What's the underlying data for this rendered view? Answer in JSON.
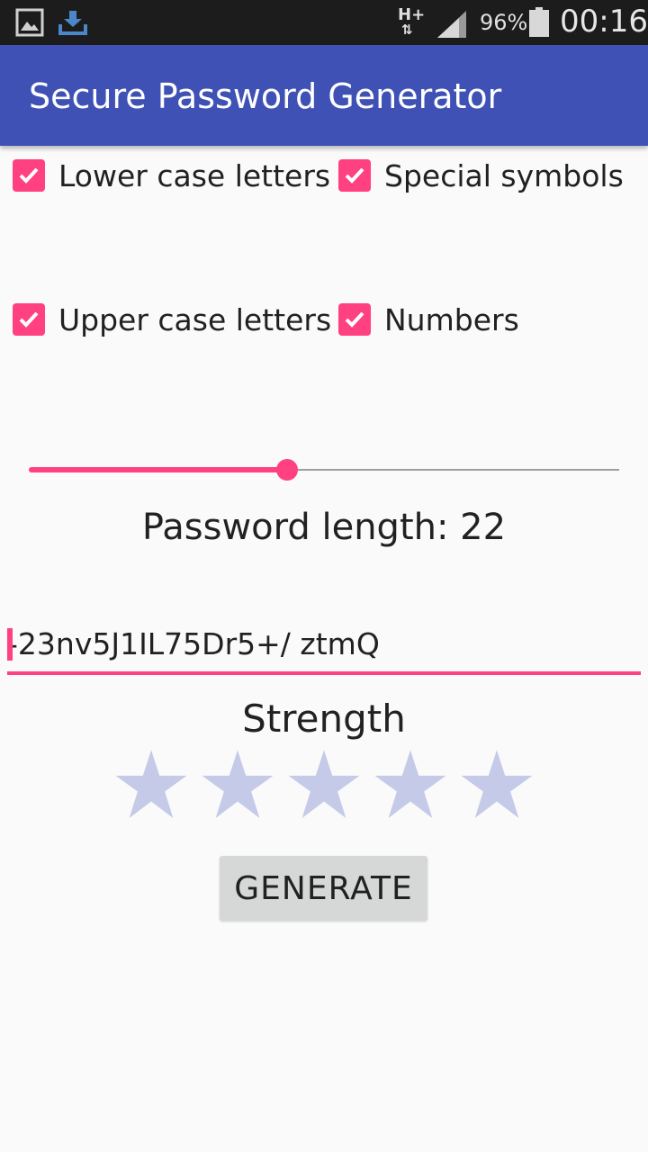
{
  "status_bar": {
    "icons": [
      "gallery-icon",
      "download-icon",
      "network-type-icon",
      "signal-icon",
      "battery-icon"
    ],
    "network_label": "H+",
    "battery_percent": "96%",
    "time": "00:16"
  },
  "app_bar": {
    "title": "Secure Password Generator"
  },
  "options": {
    "lower_case": {
      "label": "Lower case letters",
      "checked": true
    },
    "special_symbols": {
      "label": "Special symbols",
      "checked": true
    },
    "upper_case": {
      "label": "Upper case letters",
      "checked": true
    },
    "numbers": {
      "label": "Numbers",
      "checked": true
    }
  },
  "slider": {
    "value_fraction": 0.437
  },
  "length": {
    "label": "Password length: 22"
  },
  "password": {
    "value": "-23nv5J1IL75Dr5+/ ztmQ"
  },
  "strength": {
    "label": "Strength",
    "stars_total": 5,
    "stars_filled": 0
  },
  "generate_button": {
    "label": "GENERATE"
  },
  "colors": {
    "primary": "#3f51b5",
    "accent": "#ff4081",
    "star_empty": "#c5cae9",
    "status_bar": "#1c1c1c",
    "button": "#d6d7d7"
  }
}
